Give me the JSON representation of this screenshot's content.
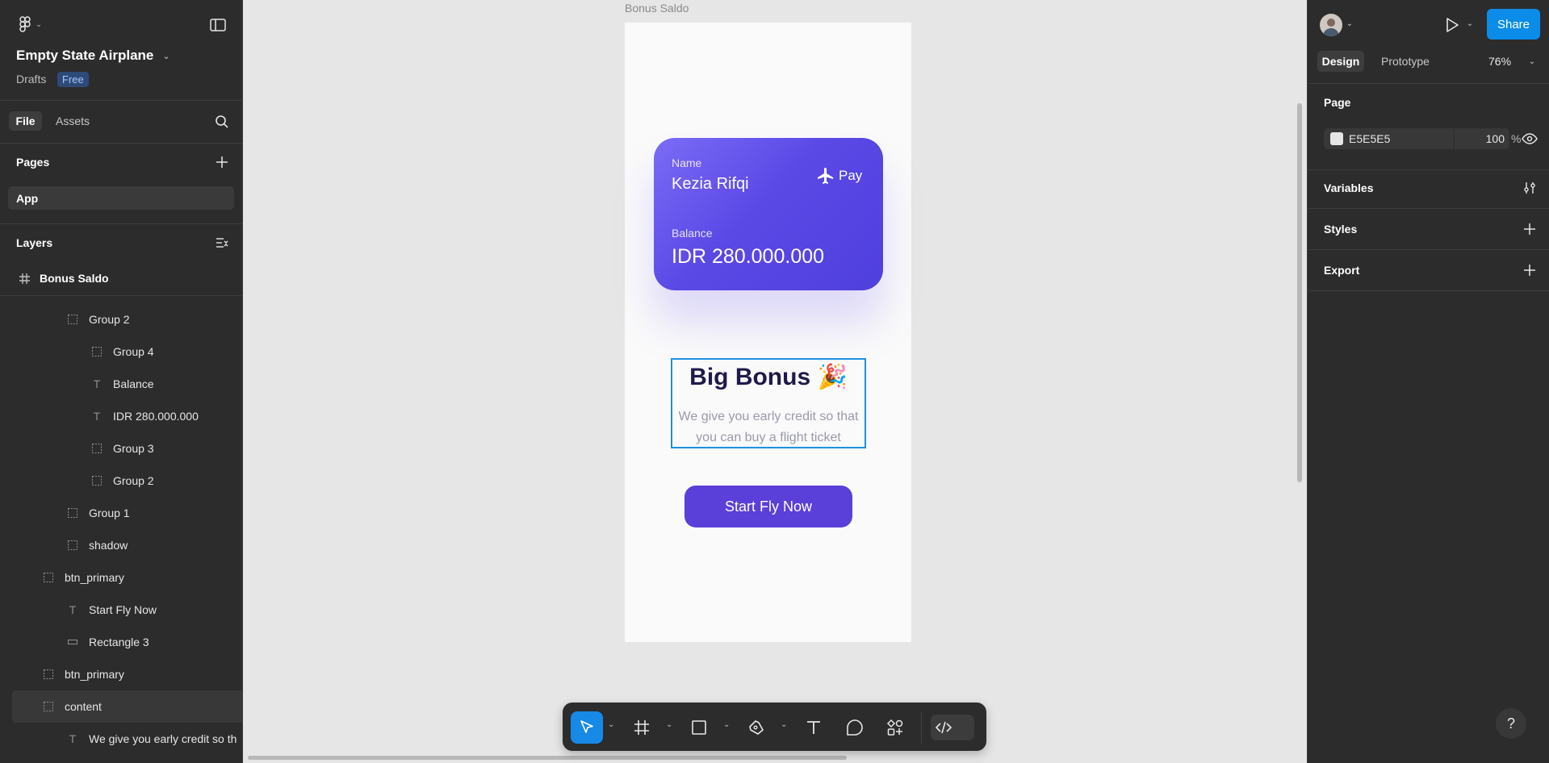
{
  "sidebar": {
    "file_title": "Empty State Airplane",
    "drafts_label": "Drafts",
    "plan_badge": "Free",
    "tabs": {
      "file": "File",
      "assets": "Assets"
    },
    "pages_title": "Pages",
    "pages": [
      {
        "label": "App"
      }
    ],
    "layers_title": "Layers",
    "frame": {
      "label": "Bonus Saldo"
    },
    "layers": [
      {
        "label": "Group 2",
        "icon": "group-icon"
      },
      {
        "label": "Group 4",
        "icon": "group-icon"
      },
      {
        "label": "Balance",
        "icon": "text-icon"
      },
      {
        "label": "IDR 280.000.000",
        "icon": "text-icon"
      },
      {
        "label": "Group 3",
        "icon": "group-icon"
      },
      {
        "label": "Group 2",
        "icon": "group-icon"
      },
      {
        "label": "Group 1",
        "icon": "group-icon"
      },
      {
        "label": "shadow",
        "icon": "group-icon"
      },
      {
        "label": "btn_primary",
        "icon": "group-icon"
      },
      {
        "label": "Start Fly Now",
        "icon": "text-icon"
      },
      {
        "label": "Rectangle 3",
        "icon": "rectangle-icon"
      },
      {
        "label": "btn_primary",
        "icon": "group-icon"
      },
      {
        "label": "content",
        "icon": "group-icon",
        "selected": true
      },
      {
        "label": "We give you early credit so th",
        "icon": "text-icon"
      }
    ]
  },
  "canvas": {
    "frame_label": "Bonus Saldo",
    "card": {
      "name_label": "Name",
      "name_value": "Kezia Rifqi",
      "pay_label": "Pay",
      "balance_label": "Balance",
      "balance_value": "IDR 280.000.000"
    },
    "bonus": {
      "title": "Big Bonus 🎉",
      "description_line1": "We give you early credit so that",
      "description_line2": "you can buy a flight ticket"
    },
    "cta_label": "Start Fly Now"
  },
  "right_panel": {
    "share_label": "Share",
    "tabs": {
      "design": "Design",
      "prototype": "Prototype"
    },
    "zoom": "76%",
    "page_title": "Page",
    "page_color": {
      "hex": "E5E5E5",
      "opacity": "100",
      "unit": "%"
    },
    "sections": {
      "variables": "Variables",
      "styles": "Styles",
      "export": "Export"
    },
    "help_label": "?"
  },
  "colors": {
    "accent": "#0C8CE9",
    "card_gradient_start": "#7B6CF6",
    "card_gradient_end": "#4F3FDC",
    "cta": "#5B3FD9",
    "selection": "#1E90E0",
    "page_background": "#E5E5E5"
  }
}
